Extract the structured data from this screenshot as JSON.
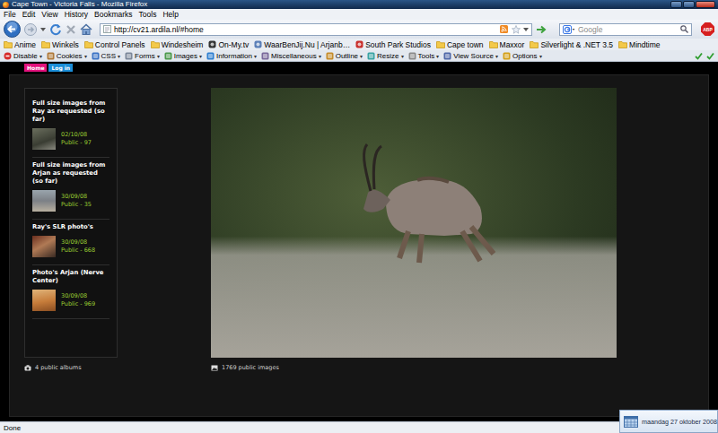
{
  "window": {
    "title": "Cape Town - Victoria Falls - Mozilla Firefox"
  },
  "menu": [
    "File",
    "Edit",
    "View",
    "History",
    "Bookmarks",
    "Tools",
    "Help"
  ],
  "navigation": {
    "url": "http://cv21.ardila.nl/#home",
    "search_placeholder": "Google",
    "adblock_label": "ABP"
  },
  "bookmarks": [
    {
      "label": "Anime",
      "kind": "folder"
    },
    {
      "label": "Winkels",
      "kind": "folder"
    },
    {
      "label": "Control Panels",
      "kind": "folder"
    },
    {
      "label": "Windesheim",
      "kind": "folder"
    },
    {
      "label": "On-My.tv",
      "kind": "site"
    },
    {
      "label": "WaarBenJij.Nu | Arjanb…",
      "kind": "site"
    },
    {
      "label": "South Park Studios",
      "kind": "site"
    },
    {
      "label": "Cape town",
      "kind": "folder"
    },
    {
      "label": "Maxxor",
      "kind": "folder"
    },
    {
      "label": "Silverlight & .NET 3.5",
      "kind": "folder"
    },
    {
      "label": "Mindtime",
      "kind": "folder"
    }
  ],
  "dev_toolbar": {
    "arrow": "▾",
    "items": [
      "Disable",
      "Cookies",
      "CSS",
      "Forms",
      "Images",
      "Information",
      "Miscellaneous",
      "Outline",
      "Resize",
      "Tools",
      "View Source",
      "Options"
    ]
  },
  "page": {
    "nav": [
      {
        "label": "Home",
        "color": "#e3127d"
      },
      {
        "label": "Log in",
        "color": "#1b8ed8"
      }
    ],
    "albums": [
      {
        "title": "Full size images from Ray as requested (so far)",
        "date": "02/10/08",
        "count": "Public - 97"
      },
      {
        "title": "Full size images from Arjan as requested (so far)",
        "date": "30/09/08",
        "count": "Public - 35"
      },
      {
        "title": "Ray's SLR photo's",
        "date": "30/09/08",
        "count": "Public - 668"
      },
      {
        "title": "Photo's Arjan (Nerve Center)",
        "date": "30/09/08",
        "count": "Public - 969"
      }
    ],
    "albums_total": "4 public albums",
    "images_total": "1769 public images"
  },
  "status_bar": {
    "text": "Done"
  },
  "notification": {
    "text": "maandag 27 oktober 2008"
  }
}
